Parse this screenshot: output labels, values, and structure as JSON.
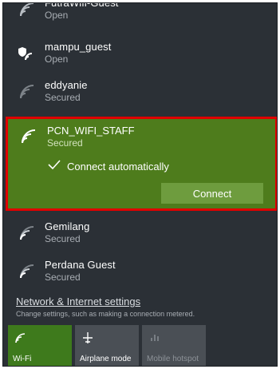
{
  "networks_top": [
    {
      "name": "FutraWifi-Guest",
      "status": "Open",
      "icon": "wifi-icon"
    },
    {
      "name": "mampu_guest",
      "status": "Open",
      "icon": "wifi-shield-icon"
    },
    {
      "name": "eddyanie",
      "status": "Secured",
      "icon": "wifi-icon"
    }
  ],
  "selected_network": {
    "name": "PCN_WIFI_STAFF",
    "status": "Secured",
    "auto_connect_label": "Connect automatically",
    "connect_button": "Connect"
  },
  "networks_bottom": [
    {
      "name": "Gemilang",
      "status": "Secured",
      "icon": "wifi-icon"
    },
    {
      "name": "Perdana Guest",
      "status": "Secured",
      "icon": "wifi-icon"
    }
  ],
  "settings": {
    "link": "Network & Internet settings",
    "description": "Change settings, such as making a connection metered."
  },
  "quick_actions": [
    {
      "label": "Wi-Fi",
      "icon": "wifi-icon"
    },
    {
      "label": "Airplane mode",
      "icon": "airplane-icon"
    },
    {
      "label": "Mobile hotspot",
      "icon": "hotspot-icon"
    }
  ],
  "colors": {
    "panel_background": "#2b3036",
    "selected_background": "#4e7c1c",
    "highlight_border": "#e00000",
    "connect_button": "#6e9c3e",
    "active_tile": "#3e7a1c"
  }
}
